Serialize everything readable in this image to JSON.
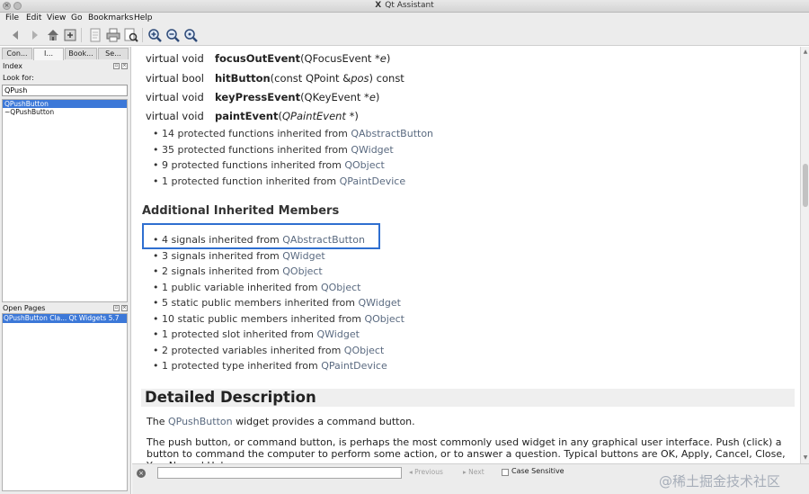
{
  "window": {
    "title": "Qt Assistant"
  },
  "menu": [
    "File",
    "Edit",
    "View",
    "Go",
    "Bookmarks",
    "Help"
  ],
  "toolbar": {
    "icons": [
      "back-arrow-icon",
      "forward-arrow-icon",
      "home-icon",
      "sync-contents-icon",
      "copy-icon",
      "print-icon",
      "find-in-text-icon",
      "zoom-in-icon",
      "zoom-out-icon",
      "reset-zoom-icon"
    ]
  },
  "sidebar": {
    "tabs": [
      "Con...",
      "I...",
      "Book...",
      "Se..."
    ],
    "active_tab": 1,
    "index_header": "Index",
    "look_for_label": "Look for:",
    "search_value": "QPush",
    "results": [
      "QPushButton",
      "~QPushButton"
    ],
    "open_pages_header": "Open Pages",
    "open_pages": [
      "QPushButton Cla... Qt Widgets 5.7"
    ]
  },
  "content": {
    "functions": [
      {
        "type": "virtual void",
        "name": "focusOutEvent",
        "pre": "(QFocusEvent *",
        "param": "e",
        "post": ")"
      },
      {
        "type": "virtual bool",
        "name": "hitButton",
        "pre": "(const QPoint &",
        "param": "pos",
        "post": ") const"
      },
      {
        "type": "virtual void",
        "name": "keyPressEvent",
        "pre": "(QKeyEvent *",
        "param": "e",
        "post": ")"
      },
      {
        "type": "virtual void",
        "name": "paintEvent",
        "pre": "(",
        "param": "QPaintEvent *",
        "post": ")"
      }
    ],
    "protected_inherited": [
      {
        "text": "14 protected functions inherited from ",
        "link": "QAbstractButton"
      },
      {
        "text": "35 protected functions inherited from ",
        "link": "QWidget"
      },
      {
        "text": "9 protected functions inherited from ",
        "link": "QObject"
      },
      {
        "text": "1 protected function inherited from ",
        "link": "QPaintDevice"
      }
    ],
    "additional_heading": "Additional Inherited Members",
    "additional": [
      {
        "text": "4 signals inherited from ",
        "link": "QAbstractButton"
      },
      {
        "text": "3 signals inherited from ",
        "link": "QWidget"
      },
      {
        "text": "2 signals inherited from ",
        "link": "QObject"
      },
      {
        "text": "1 public variable inherited from ",
        "link": "QObject"
      },
      {
        "text": "5 static public members inherited from ",
        "link": "QWidget"
      },
      {
        "text": "10 static public members inherited from ",
        "link": "QObject"
      },
      {
        "text": "1 protected slot inherited from ",
        "link": "QWidget"
      },
      {
        "text": "2 protected variables inherited from ",
        "link": "QObject"
      },
      {
        "text": "1 protected type inherited from ",
        "link": "QPaintDevice"
      }
    ],
    "detailed_heading": "Detailed Description",
    "para1_pre": "The ",
    "para1_link": "QPushButton",
    "para1_post": " widget provides a command button.",
    "para2": "The push button, or command button, is perhaps the most commonly used widget in any graphical user interface. Push (click) a button to command the computer to perform some action, or to answer a question. Typical buttons are OK, Apply, Cancel, Close, Yes, No and Help."
  },
  "findbar": {
    "previous_label": "Previous",
    "next_label": "Next",
    "case_sensitive_label": "Case Sensitive",
    "case_sensitive_checked": false
  },
  "watermark": "@稀土掘金技术社区"
}
